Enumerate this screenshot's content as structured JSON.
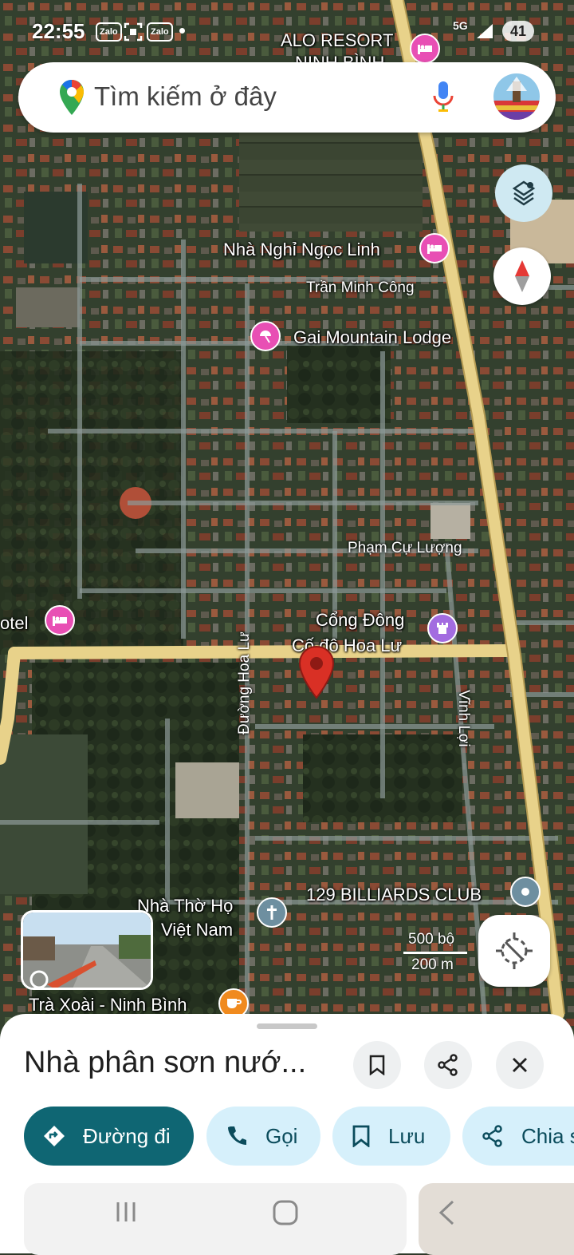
{
  "status_bar": {
    "time": "22:55",
    "notification_icons": [
      "Zalo",
      "Zalo"
    ],
    "network": "5G",
    "battery": "41"
  },
  "search": {
    "placeholder": "Tìm kiếm ở đây",
    "mic_icon": "mic-icon",
    "avatar_icon": "profile-avatar"
  },
  "map": {
    "pois": [
      {
        "name": "ALO RESORT",
        "subname": "NINH BÌNH",
        "type": "hotel"
      },
      {
        "name": "Nhà Nghỉ Ngọc Linh",
        "type": "hotel"
      },
      {
        "name": "Gai Mountain Lodge",
        "type": "resort"
      },
      {
        "name": "Cổng Đông",
        "subname": "Cố đô Hoa Lư",
        "type": "landmark"
      },
      {
        "name": "otel",
        "type": "hotel"
      },
      {
        "name": "129 BILLIARDS CLUB",
        "type": "place"
      },
      {
        "name": "Nhà Thờ Họ",
        "subname": "Việt Nam",
        "type": "church"
      },
      {
        "name": "Trà Xoài - Ninh Bình",
        "type": "cafe"
      }
    ],
    "streets": [
      "Trần Minh Công",
      "Phạm Cự Lượng",
      "Đường Hoa Lư",
      "Vĩnh Lợi"
    ],
    "scale": {
      "feet": "500 bộ",
      "meters": "200 m"
    },
    "colors": {
      "road_major": "#e8d28a",
      "hotel_pin": "#e84fb4",
      "landmark_pin": "#a36ce0",
      "cafe_pin": "#f08a1e",
      "place_pin": "#6e8fa0",
      "church_pin": "#6e8fa0",
      "marker": "#d93025"
    }
  },
  "sheet": {
    "title": "Nhà phân sơn nướ...",
    "actions": [
      {
        "label": "Đường đi",
        "icon": "directions-icon"
      },
      {
        "label": "Gọi",
        "icon": "phone-icon"
      },
      {
        "label": "Lưu",
        "icon": "bookmark-icon"
      },
      {
        "label": "Chia sẻ",
        "icon": "share-icon"
      }
    ],
    "header_buttons": [
      "bookmark-icon",
      "share-icon",
      "close-icon"
    ],
    "colors": {
      "primary": "#0f6673",
      "chip": "#d6f0fb"
    }
  },
  "nav_bar": [
    "recent-apps-icon",
    "home-icon",
    "back-icon"
  ]
}
